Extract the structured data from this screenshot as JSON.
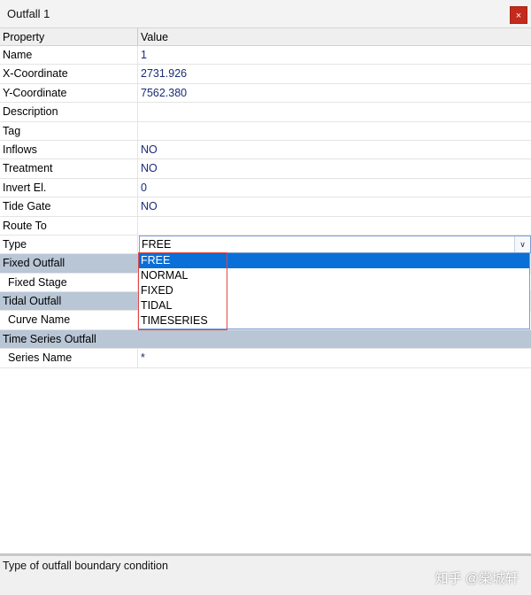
{
  "window": {
    "title": "Outfall 1",
    "close_label": "×"
  },
  "table": {
    "header": {
      "property": "Property",
      "value": "Value"
    },
    "rows": [
      {
        "name": "Name",
        "value": "1"
      },
      {
        "name": "X-Coordinate",
        "value": "2731.926"
      },
      {
        "name": "Y-Coordinate",
        "value": "7562.380"
      },
      {
        "name": "Description",
        "value": ""
      },
      {
        "name": "Tag",
        "value": ""
      },
      {
        "name": "Inflows",
        "value": "NO"
      },
      {
        "name": "Treatment",
        "value": "NO"
      },
      {
        "name": "Invert El.",
        "value": "0"
      },
      {
        "name": "Tide Gate",
        "value": "NO"
      },
      {
        "name": "Route To",
        "value": ""
      },
      {
        "name": "Type",
        "value": "FREE"
      },
      {
        "name": "Fixed Outfall",
        "value": ""
      },
      {
        "name": "Fixed Stage",
        "value": ""
      },
      {
        "name": "Tidal Outfall",
        "value": ""
      },
      {
        "name": "Curve Name",
        "value": ""
      },
      {
        "name": "Time Series Outfall",
        "value": ""
      },
      {
        "name": "Series Name",
        "value": "*"
      }
    ]
  },
  "dropdown": {
    "options": [
      "FREE",
      "NORMAL",
      "FIXED",
      "TIDAL",
      "TIMESERIES"
    ],
    "selected": "FREE"
  },
  "status": {
    "text": "Type of outfall boundary condition"
  },
  "watermark": {
    "text": "知乎 @棠城轩"
  },
  "colors": {
    "group_header": "#b8c6d6",
    "selection": "#0a6fd6",
    "highlight_box": "#e04646",
    "close_button": "#c42b1c"
  }
}
